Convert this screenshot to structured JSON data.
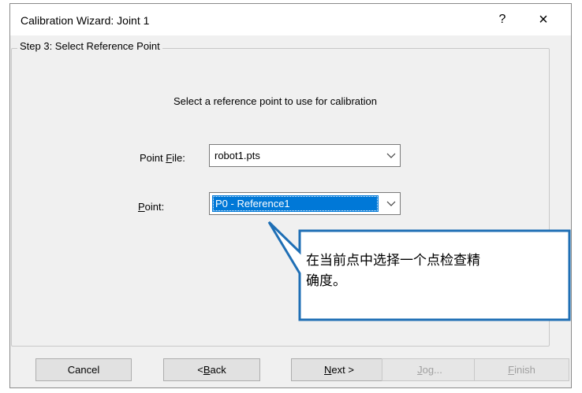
{
  "window": {
    "title": "Calibration Wizard: Joint 1",
    "help_label": "?",
    "close_label": "×"
  },
  "step": {
    "legend": "Step 3: Select Reference Point",
    "instruction": "Select a reference point to use for calibration"
  },
  "fields": {
    "point_file": {
      "label_prefix": "Point ",
      "label_accel": "F",
      "label_suffix": "ile:",
      "value": "robot1.pts"
    },
    "point": {
      "label_prefix": "",
      "label_accel": "P",
      "label_suffix": "oint:",
      "value": "P0 - Reference1"
    }
  },
  "callout": {
    "text_line1": "在当前点中选择一个点检查精",
    "text_line2": "确度。",
    "border_color": "#1f6fb5"
  },
  "buttons": {
    "cancel": {
      "label": "Cancel"
    },
    "back": {
      "prefix": "< ",
      "accel": "B",
      "suffix": "ack"
    },
    "next": {
      "prefix": "",
      "accel": "N",
      "suffix": "ext >"
    },
    "jog": {
      "prefix": "",
      "accel": "J",
      "suffix": "og..."
    },
    "finish": {
      "prefix": "",
      "accel": "F",
      "suffix": "inish"
    }
  },
  "colors": {
    "selection": "#0078d7",
    "dialog_bg": "#f0f0f0"
  }
}
